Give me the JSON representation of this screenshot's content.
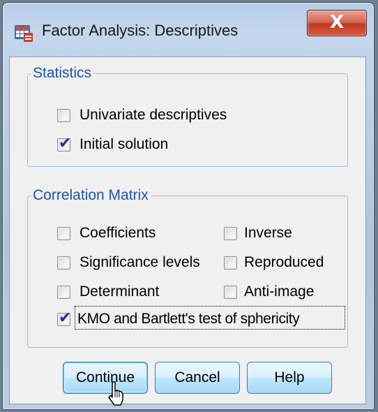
{
  "window": {
    "title": "Factor Analysis: Descriptives",
    "close_label": "X"
  },
  "statistics": {
    "legend": "Statistics",
    "items": [
      {
        "label": "Univariate descriptives",
        "checked": false
      },
      {
        "label": "Initial solution",
        "checked": true
      }
    ]
  },
  "correlation_matrix": {
    "legend": "Correlation Matrix",
    "left": [
      {
        "label": "Coefficients",
        "checked": false
      },
      {
        "label": "Significance levels",
        "checked": false
      },
      {
        "label": "Determinant",
        "checked": false
      }
    ],
    "right": [
      {
        "label": "Inverse",
        "checked": false
      },
      {
        "label": "Reproduced",
        "checked": false
      },
      {
        "label": "Anti-image",
        "checked": false
      }
    ],
    "kmo": {
      "label": "KMO and Bartlett's test of sphericity",
      "checked": true
    }
  },
  "buttons": {
    "continue": "Continue",
    "cancel": "Cancel",
    "help": "Help"
  }
}
